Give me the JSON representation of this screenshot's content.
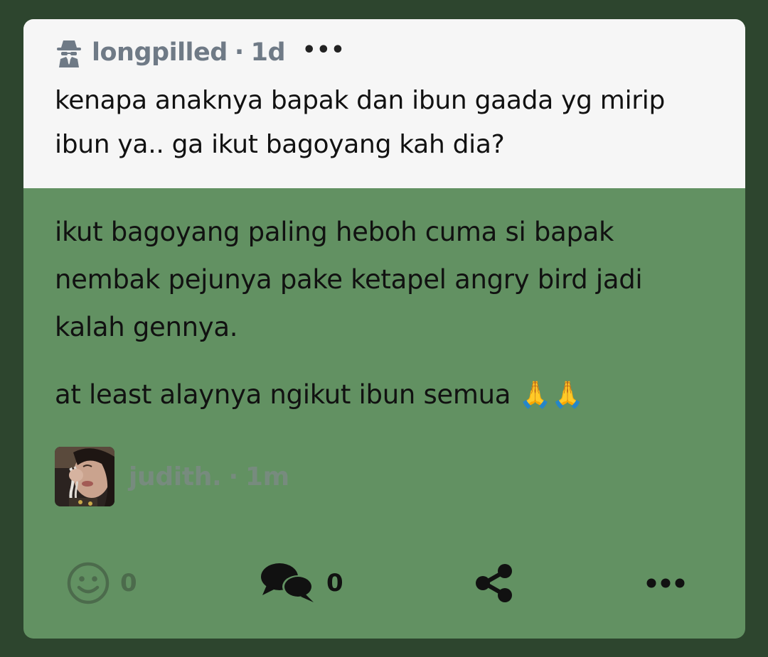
{
  "post": {
    "author": "longpilled",
    "separator": "·",
    "age": "1d",
    "more_label": "•••",
    "text": "kenapa anaknya bapak dan ibun gaada yg mirip ibun ya.. ga ikut bagoyang kah dia?"
  },
  "reply": {
    "paragraph_1": "ikut bagoyang paling heboh cuma si bapak nembak pejunya pake ketapel angry bird jadi kalah gennya.",
    "paragraph_2": "at least alaynya ngikut ibun semua 🙏🙏",
    "author": "judith.",
    "separator": "·",
    "age": "1m"
  },
  "actions": {
    "reaction_count": "0",
    "comment_count": "0"
  },
  "icons": {
    "anon": "incognito-icon",
    "react": "smiley-icon",
    "comments": "comments-icon",
    "share": "share-icon",
    "more": "more-icon"
  },
  "colors": {
    "background": "#2d452e",
    "card_green": "#629162",
    "quote_bg": "#f6f6f6",
    "meta_gray": "#6f7a86"
  }
}
